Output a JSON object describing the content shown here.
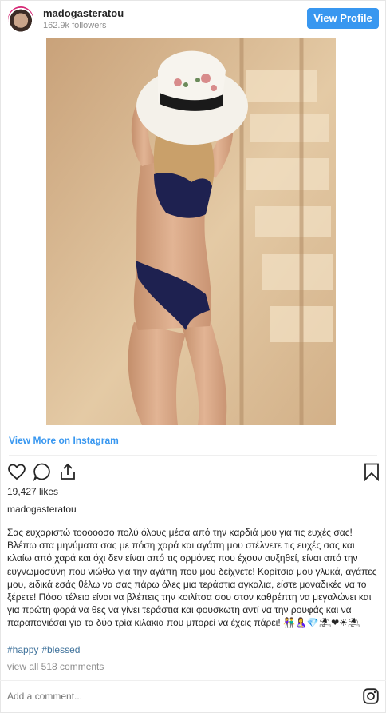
{
  "header": {
    "username": "madogasteratou",
    "followers": "162.9k followers",
    "view_profile_label": "View Profile",
    "accent_color": "#3897f0"
  },
  "post": {
    "image_description_icon": "photo",
    "view_more_label": "View More on Instagram",
    "likes": "19,427 likes",
    "owner": "madogasteratou",
    "caption": "Σας ευχαριστώ τοοοοοσο πολύ όλους μέσα από την καρδιά μου για τις ευχές σας! Βλέπω στα μηνύματα σας με πόση χαρά και αγάπη μου στέλνετε τις ευχές σας και κλαίω από χαρά και όχι δεν είναι από τις ορμόνες που έχουν αυξηθεί, είναι από την ευγνωμοσύνη που νιώθω για την αγάπη που μου δείχνετε! Κορίτσια μου γλυκά, αγάπες μου, ειδικά εσάς θέλω να σας πάρω όλες μια τεράστια αγκαλια, είστε μοναδικές να το ξέρετε! Πόσο τέλειο είναι να βλέπεις την κοιλίτσα σου στον καθρέπτη να μεγαλώνει και για πρώτη φορά να θες να γίνει τεράστια και φουσκωτη αντί να την ρουφάς και να παραπονιέσαι για τα δύο τρία κιλακια που μπορεί να έχεις πάρει! 👫🤱💎⛱❤☀⛱",
    "hashtags": [
      "#happy",
      "#blessed"
    ],
    "comments_link": "view all 518 comments",
    "add_comment_placeholder": "Add a comment...",
    "link_color": "#3f729b"
  },
  "icons": {
    "like": "heart-icon",
    "comment": "comment-icon",
    "share": "share-icon",
    "save": "bookmark-icon",
    "instagram": "instagram-icon"
  }
}
